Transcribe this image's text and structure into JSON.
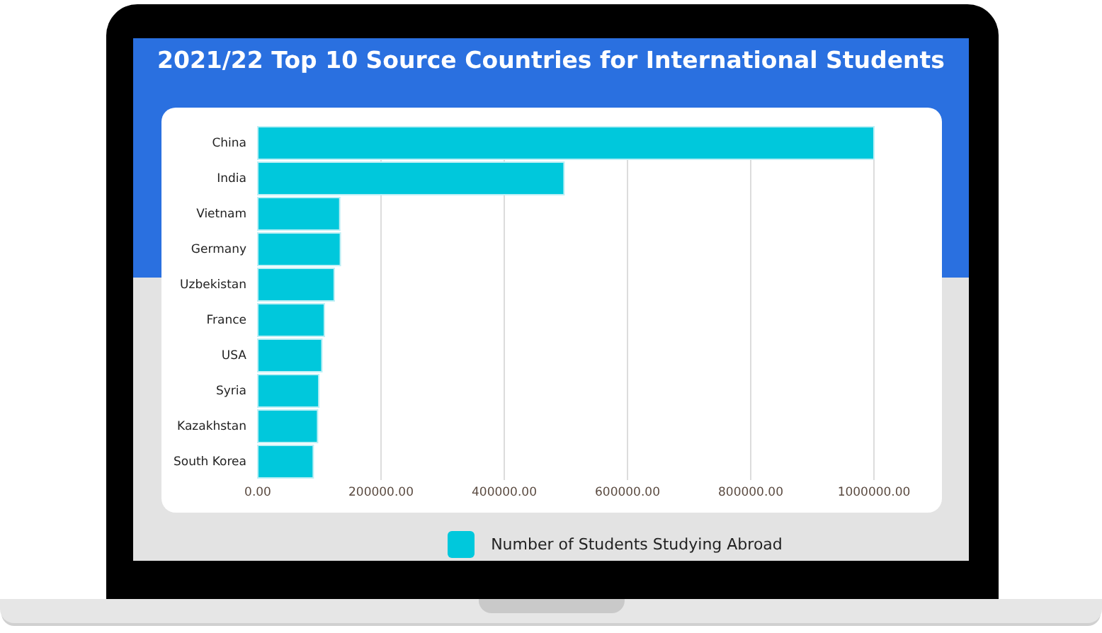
{
  "screen": {
    "title": "2021/22 Top 10 Source Countries for International Students",
    "chart_data": {
      "type": "bar",
      "orientation": "horizontal",
      "categories": [
        "China",
        "India",
        "Vietnam",
        "Germany",
        "Uzbekistan",
        "France",
        "USA",
        "Syria",
        "Kazakhstan",
        "South Korea"
      ],
      "series": [
        {
          "name": "Number of Students Studying Abroad",
          "color": "#00c8dc",
          "values": [
            1000000,
            497000,
            133000,
            134000,
            124000,
            108000,
            104000,
            99000,
            97000,
            90000
          ]
        }
      ],
      "xlim": [
        0,
        1000000
      ],
      "grid": true,
      "xticks": [
        {
          "value": 0,
          "label": "0.00"
        },
        {
          "value": 200000,
          "label": "200000.00"
        },
        {
          "value": 400000,
          "label": "400000.00"
        },
        {
          "value": 600000,
          "label": "600000.00"
        },
        {
          "value": 800000,
          "label": "800000.00"
        },
        {
          "value": 1000000,
          "label": "1000000.00"
        }
      ]
    }
  }
}
